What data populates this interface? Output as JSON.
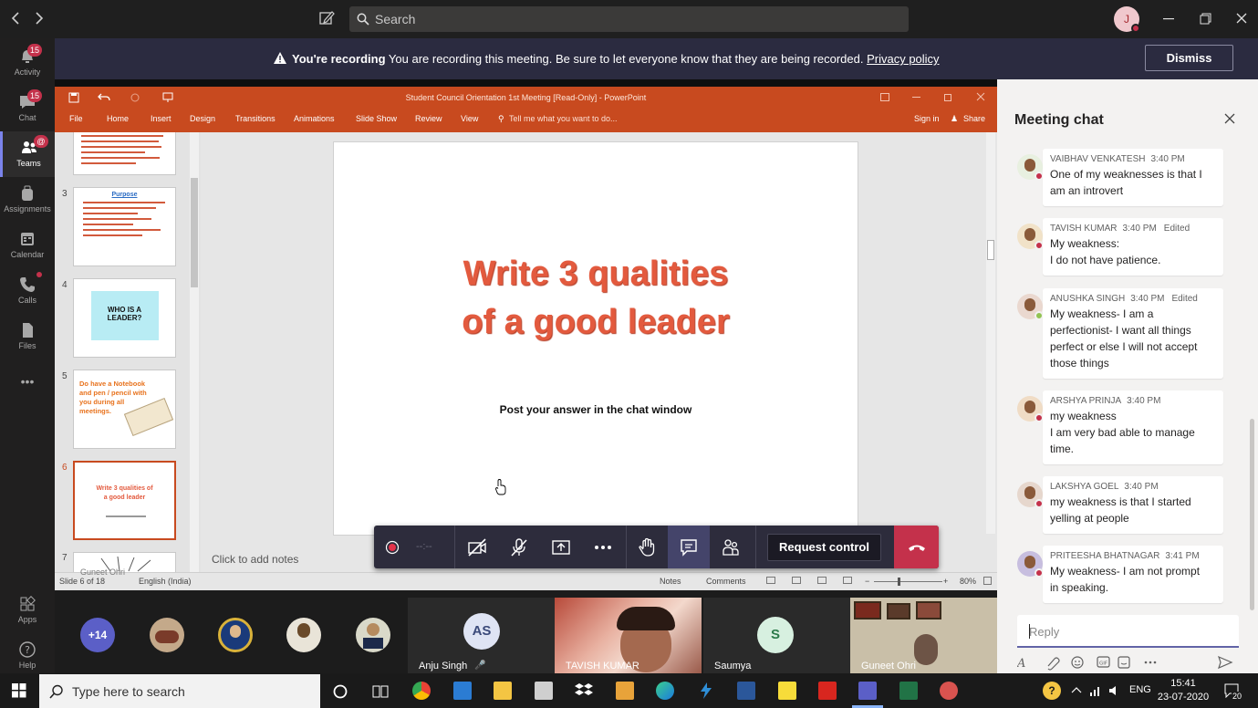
{
  "window": {
    "search_placeholder": "Search",
    "avatar_initial": "J"
  },
  "rail": {
    "items": [
      {
        "label": "Activity",
        "badge": "15"
      },
      {
        "label": "Chat",
        "badge": "15"
      },
      {
        "label": "Teams",
        "badge": "@"
      },
      {
        "label": "Assignments",
        "badge": ""
      },
      {
        "label": "Calendar",
        "badge": ""
      },
      {
        "label": "Calls",
        "badge": ""
      },
      {
        "label": "Files",
        "badge": ""
      },
      {
        "label": "•••",
        "badge": ""
      },
      {
        "label": "Apps",
        "badge": ""
      },
      {
        "label": "Help",
        "badge": ""
      }
    ]
  },
  "banner": {
    "bold": "You're recording",
    "text": " You are recording this meeting. Be sure to let everyone know that they are being recorded. ",
    "link": "Privacy policy",
    "dismiss": "Dismiss"
  },
  "ppt": {
    "title": "Student Council Orientation 1st Meeting [Read-Only] - PowerPoint",
    "ribbon": [
      "File",
      "Home",
      "Insert",
      "Design",
      "Transitions",
      "Animations",
      "Slide Show",
      "Review",
      "View"
    ],
    "tell_me": "Tell me what you want to do...",
    "sign_in": "Sign in",
    "share": "Share",
    "thumb_numbers": [
      "3",
      "4",
      "5",
      "6",
      "7"
    ],
    "thumb3_title": "Purpose",
    "thumb4_text": "WHO IS A LEADER?",
    "thumb5_text": "Do have a Notebook and pen / pencil with you during all meetings.",
    "thumb6_text": "Write 3 qualities of a good leader",
    "slide_title_1": "Write 3 qualities",
    "slide_title_2": "of a good leader",
    "slide_sub": "Post your answer in the chat window",
    "notes_hint": "Click to add notes",
    "status_slide": "Slide 6 of 18",
    "status_lang": "English (India)",
    "status_notes": "Notes",
    "status_comments": "Comments",
    "zoom": "80%",
    "presenter_watermark": "Guneet Ohri"
  },
  "controls": {
    "timer": "--:--",
    "request_control": "Request control"
  },
  "strip": {
    "overflow": "+14",
    "tiles": [
      {
        "name": "Anju Singh",
        "initials": "AS"
      },
      {
        "name": "TAVISH KUMAR",
        "initials": ""
      },
      {
        "name": "Saumya",
        "initials": "S"
      },
      {
        "name": "Guneet Ohri",
        "initials": ""
      }
    ]
  },
  "chat": {
    "title": "Meeting chat",
    "reply_placeholder": "Reply",
    "messages": [
      {
        "name": "VAIBHAV VENKATESH",
        "time": "3:40 PM",
        "edited": "",
        "lines": [
          "One of my weaknesses is that I",
          "am an introvert"
        ],
        "status": "#c4314b"
      },
      {
        "name": "TAVISH KUMAR",
        "time": "3:40 PM",
        "edited": "Edited",
        "lines": [
          "My weakness:",
          "I do not have patience."
        ],
        "status": "#c4314b"
      },
      {
        "name": "ANUSHKA SINGH",
        "time": "3:40 PM",
        "edited": "Edited",
        "lines": [
          "My weakness- I am a",
          "perfectionist- I want all things",
          "perfect or else I will not accept",
          "those things"
        ],
        "status": "#92c353"
      },
      {
        "name": "ARSHYA PRINJA",
        "time": "3:40 PM",
        "edited": "",
        "lines": [
          "my weakness",
          "I am very bad able to manage",
          "time."
        ],
        "status": "#c4314b"
      },
      {
        "name": "LAKSHYA GOEL",
        "time": "3:40 PM",
        "edited": "",
        "lines": [
          "my weakness is that I started",
          "yelling at people"
        ],
        "status": "#c4314b"
      },
      {
        "name": "PRITEESHA BHATNAGAR",
        "time": "3:41 PM",
        "edited": "",
        "lines": [
          "My weakness- I am not prompt",
          "in speaking."
        ],
        "status": "#c4314b"
      }
    ]
  },
  "taskbar": {
    "search_placeholder": "Type here to search",
    "lang": "ENG",
    "time": "15:41",
    "date": "23-07-2020",
    "notif": "20"
  },
  "colors": {
    "accent": "#6264a7",
    "ppt": "#c84a1f",
    "hangup": "#c4314b",
    "slide_text": "#e35a3e"
  }
}
